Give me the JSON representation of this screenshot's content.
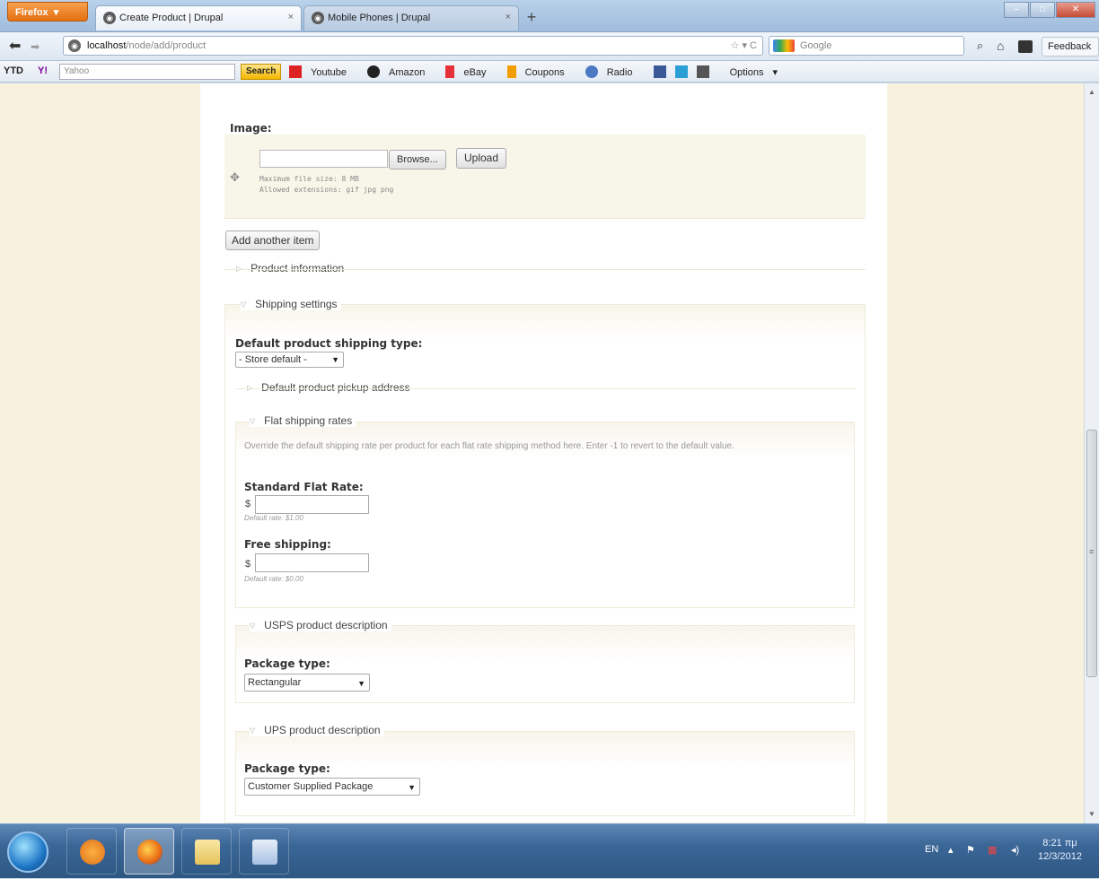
{
  "browser": {
    "app_button": "Firefox",
    "tabs": [
      {
        "label": "Create Product | Drupal",
        "active": true
      },
      {
        "label": "Mobile Phones | Drupal",
        "active": false
      }
    ],
    "url_host": "localhost",
    "url_path": "/node/add/product",
    "search_placeholder": "Google",
    "feedback_label": "Feedback"
  },
  "toolbar": {
    "ytd_label": "YTD",
    "yahoo_label": "Y!",
    "yahoo_placeholder": "Yahoo",
    "search_button": "Search",
    "links": [
      "Youtube",
      "Amazon",
      "eBay",
      "Coupons",
      "Radio",
      "Options"
    ]
  },
  "form": {
    "image_label": "Image:",
    "browse_button": "Browse...",
    "upload_button": "Upload",
    "max_file_size": "Maximum file size: 8 MB",
    "allowed_ext": "Allowed extensions: gif jpg png",
    "add_item_button": "Add another item",
    "product_information": "Product information",
    "shipping_settings": "Shipping settings",
    "default_shipping_type_label": "Default product shipping type:",
    "default_shipping_type_value": "- Store default -",
    "default_pickup_address": "Default product pickup address",
    "flat_rates": {
      "legend": "Flat shipping rates",
      "description": "Override the default shipping rate per product for each flat rate shipping method here. Enter -1 to revert to the default value.",
      "standard_label": "Standard Flat Rate:",
      "standard_currency": "$",
      "standard_default": "Default rate: $1.00",
      "free_label": "Free shipping:",
      "free_currency": "$",
      "free_default": "Default rate: $0.00"
    },
    "usps": {
      "legend": "USPS product description",
      "package_label": "Package type:",
      "package_value": "Rectangular"
    },
    "ups": {
      "legend": "UPS product description",
      "package_label": "Package type:",
      "package_value": "Customer Supplied Package"
    }
  },
  "taskbar": {
    "language": "EN",
    "time": "8:21 πμ",
    "date": "12/3/2012"
  }
}
